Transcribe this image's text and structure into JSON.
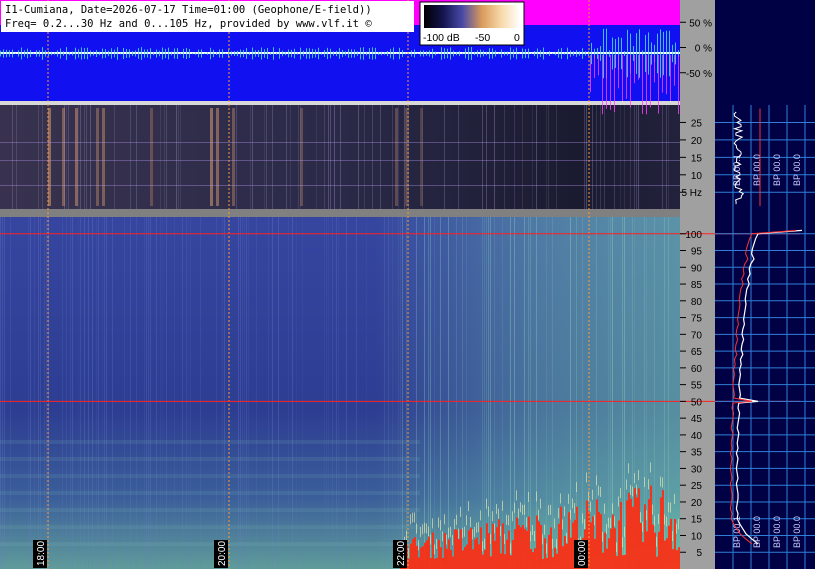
{
  "header": {
    "line1": "I1-Cumiana, Date=2026-07-17 Time=01:00 (Geophone/E-field))",
    "line2": "Freq= 0.2...30 Hz and 0...105 Hz, provided by www.vlf.it ©"
  },
  "colorbar": {
    "labels": [
      "-100 dB",
      "-50",
      "0"
    ]
  },
  "colors": {
    "waveform_bg": "#ff00ff",
    "waveform_fill": "#1010f0",
    "spectrogram_bg": "#2a3a8c",
    "panel_gray": "#a0a0a0",
    "right_panel_bg": "#000044",
    "grid_blue": "#2f7fd8",
    "marker_orange": "#ff9a3a",
    "red_line": "#ff2020"
  },
  "chart_data": [
    {
      "type": "line",
      "name": "waveform-panel",
      "ylabel_ticks": [
        "50 %",
        "0 %",
        "-50 %"
      ],
      "y_ticks": [
        50,
        0,
        -50
      ],
      "ylim": [
        -100,
        100
      ]
    },
    {
      "type": "heatmap",
      "name": "low-frequency-spectrogram",
      "y_ticks": [
        25,
        20,
        15,
        10,
        5
      ],
      "y_tick_labels": [
        "25",
        "20",
        "15",
        "10",
        "5 Hz"
      ],
      "ylim": [
        0.2,
        30
      ],
      "right_axis_labels": [
        "BP 00.1",
        "BP 00.0",
        "BP 00.0",
        "BP 00.0"
      ]
    },
    {
      "type": "heatmap",
      "name": "full-spectrogram",
      "y_ticks": [
        100,
        95,
        90,
        85,
        80,
        75,
        70,
        65,
        60,
        55,
        50,
        45,
        40,
        35,
        30,
        25,
        20,
        15,
        10,
        5
      ],
      "ylim": [
        0,
        105
      ],
      "hline_values": [
        100,
        50
      ],
      "right_axis_labels": [
        "BP 00.1",
        "BP 00.0",
        "BP 00.0",
        "BP 00.0"
      ],
      "spectrum_profile_x": [
        0.35,
        0.32,
        0.3,
        0.28,
        0.27,
        0.3,
        0.26,
        0.24,
        0.25,
        0.22,
        0.9,
        0.24,
        0.21,
        0.2,
        0.19,
        0.2,
        0.19,
        0.18,
        0.17,
        0.18,
        0.16,
        0.15,
        0.17,
        0.15,
        0.14,
        0.16,
        0.13,
        0.14,
        0.12,
        0.13,
        0.12,
        0.11,
        0.12,
        0.13,
        0.12,
        0.11,
        0.1,
        0.12,
        0.11,
        0.1,
        0.09,
        0.11,
        0.1,
        0.09,
        0.1,
        0.08,
        0.1,
        0.09,
        0.08,
        0.09,
        0.1,
        0.08,
        0.09,
        0.1,
        0.35,
        0.1,
        0.09,
        0.08,
        0.1,
        0.09,
        0.12,
        0.16,
        0.2,
        0.27,
        0.35
      ],
      "spectrum_profile_y": [
        100,
        98.5,
        97,
        95.5,
        94,
        92.5,
        91,
        89.5,
        88,
        86.5,
        101,
        85,
        83.5,
        82,
        80.5,
        79,
        77.5,
        76,
        74.5,
        73,
        71.5,
        70,
        68.5,
        67,
        65.5,
        64,
        62.5,
        61,
        59.5,
        58,
        56.5,
        55,
        53.5,
        52,
        51,
        49.5,
        48,
        46.5,
        45,
        43.5,
        42,
        40.5,
        39,
        37.5,
        36,
        34.5,
        33,
        31.5,
        30,
        28.5,
        27,
        25.5,
        24,
        22.5,
        50,
        21,
        19.5,
        18,
        16.5,
        15,
        13.5,
        12,
        10.5,
        9,
        7.5
      ]
    },
    {
      "type": "line",
      "name": "time-axis",
      "x_tick_labels": [
        "18:00",
        "20:00",
        "22:00",
        "00:00"
      ]
    }
  ]
}
